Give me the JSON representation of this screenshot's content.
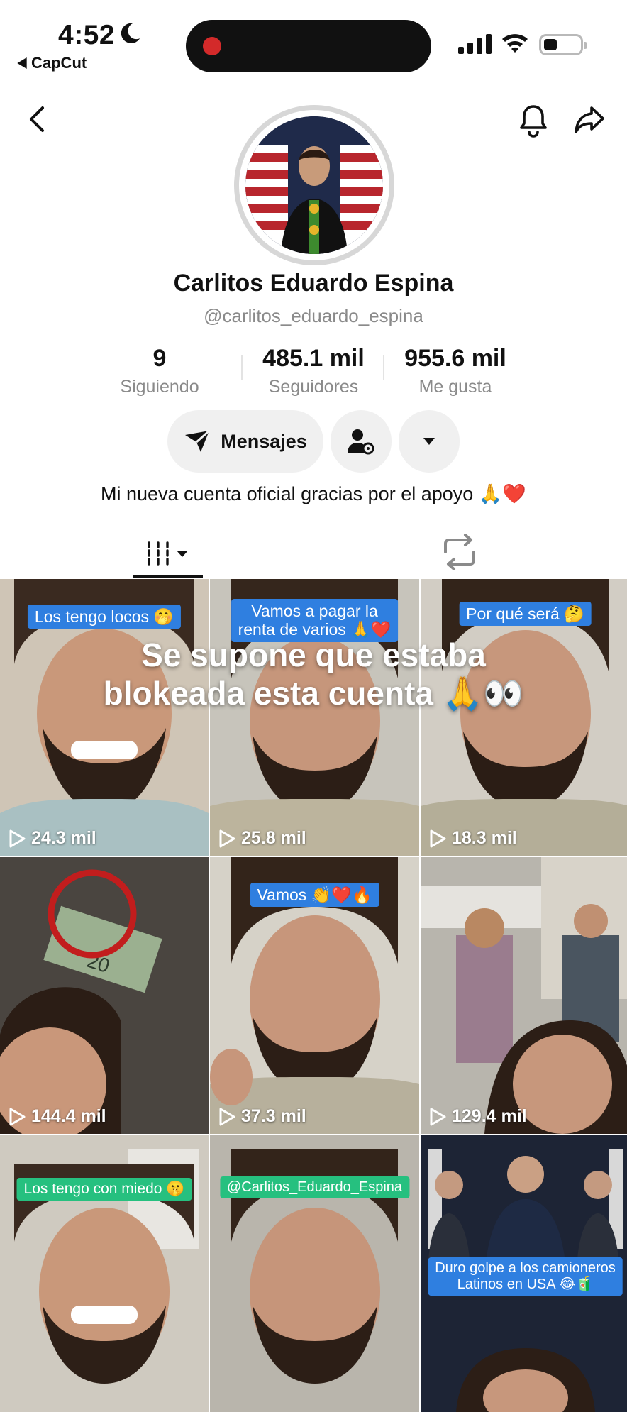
{
  "status_bar": {
    "time": "4:52",
    "back_app_label": "CapCut"
  },
  "profile": {
    "name": "Carlitos Eduardo Espina",
    "handle": "@carlitos_eduardo_espina",
    "stats": [
      {
        "value": "9",
        "label": "Siguiendo"
      },
      {
        "value": "485.1 mil",
        "label": "Seguidores"
      },
      {
        "value": "955.6 mil",
        "label": "Me gusta"
      }
    ],
    "message_button_label": "Mensajes",
    "bio": "Mi nueva cuenta oficial gracias por el apoyo 🙏❤️"
  },
  "overlay_caption": {
    "line1": "Se supone que estaba",
    "line2": "blokeada esta cuenta 🙏👀"
  },
  "videos": [
    {
      "views": "24.3 mil",
      "caption": "Los tengo locos 🤭"
    },
    {
      "views": "25.8 mil",
      "caption_line1": "Vamos a pagar la",
      "caption_line2": "renta de varios 🙏❤️"
    },
    {
      "views": "18.3 mil",
      "caption": "Por qué será 🤔"
    },
    {
      "views": "144.4 mil",
      "caption": ""
    },
    {
      "views": "37.3 mil",
      "caption": "Vamos 👏❤️🔥"
    },
    {
      "views": "129.4 mil",
      "caption": ""
    },
    {
      "views": "",
      "caption": "Los tengo con miedo 🤫"
    },
    {
      "views": "",
      "caption": "@Carlitos_Eduardo_Espina"
    },
    {
      "views": "",
      "caption_line1": "Duro golpe a los camioneros",
      "caption_line2": "Latinos en USA 😂🧃"
    }
  ],
  "colors": {
    "recording_dot": "#d32a2a",
    "caption_blue": "#2f7fe0",
    "caption_green": "#26c07f",
    "muted_text": "#8a8a8a"
  }
}
